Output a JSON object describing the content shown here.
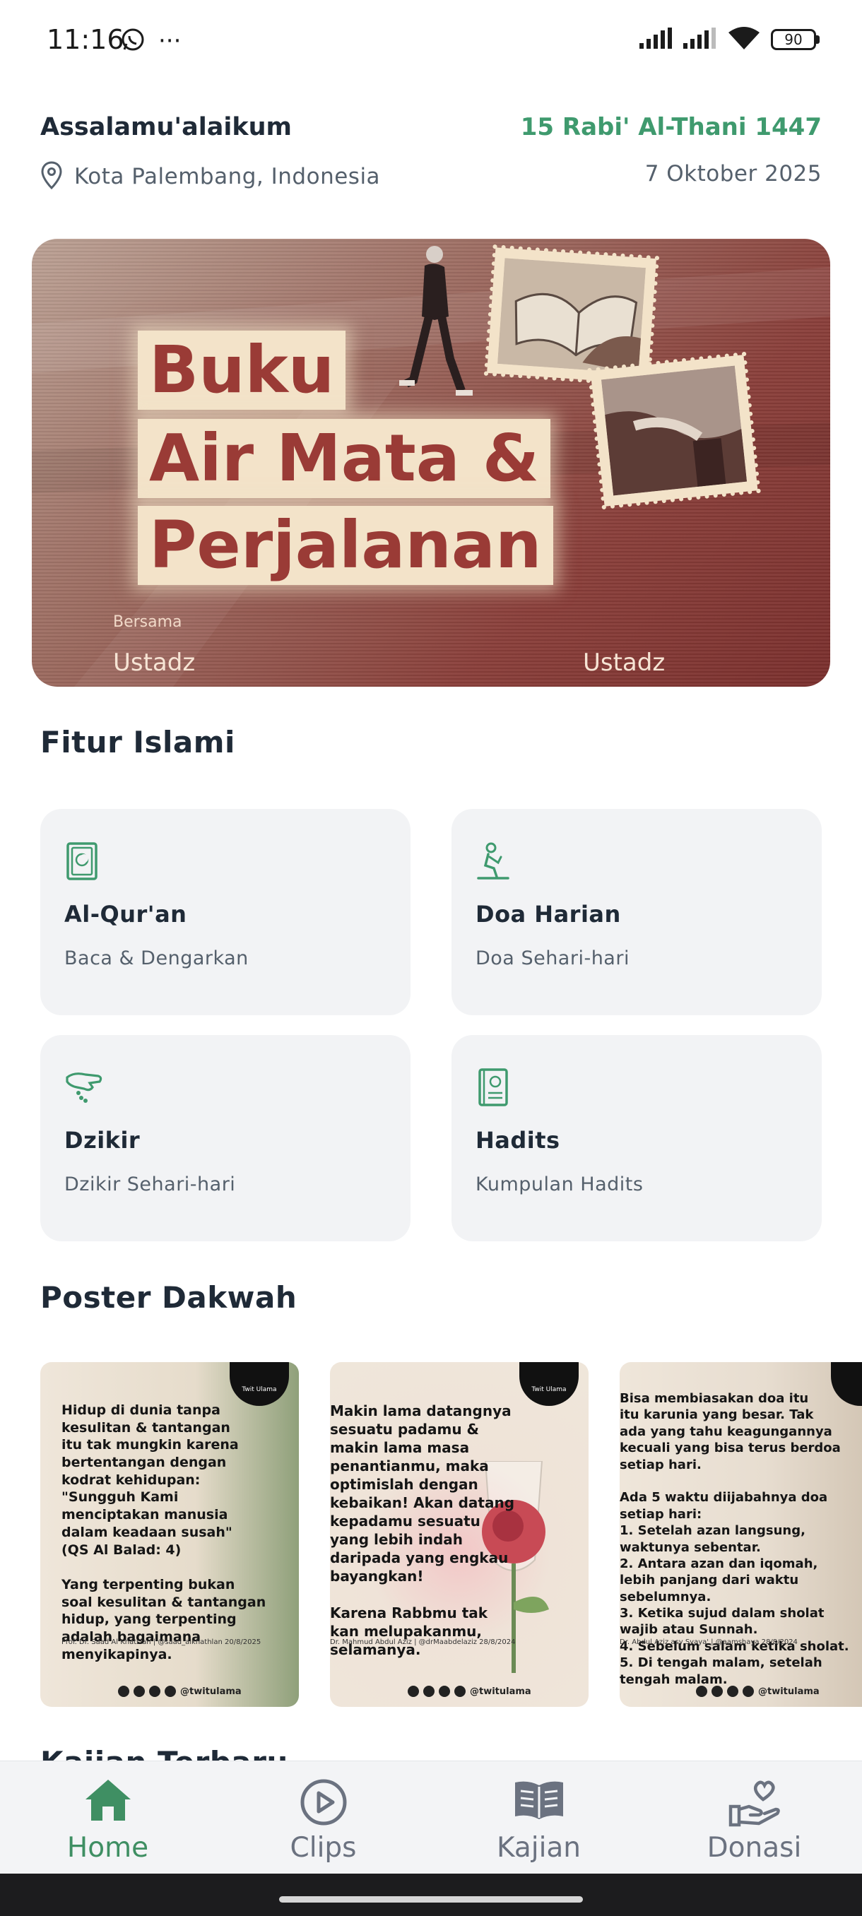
{
  "status_bar": {
    "time": "11:16",
    "battery": "90"
  },
  "header": {
    "greeting": "Assalamu'alaikum",
    "hijri_date": "15 Rabi' Al-Thani 1447",
    "location": "Kota Palembang, Indonesia",
    "gregorian_date": "7 Oktober 2025"
  },
  "banner": {
    "title_lines": [
      "Buku",
      "Air Mata &",
      "Perjalanan"
    ],
    "with_label": "Bersama",
    "speaker_1": "Ustadz",
    "speaker_2": "Ustadz"
  },
  "features": {
    "title": "Fitur Islami",
    "items": [
      {
        "title": "Al-Qur'an",
        "subtitle": "Baca & Dengarkan",
        "icon": "quran-book-icon"
      },
      {
        "title": "Doa Harian",
        "subtitle": "Doa Sehari-hari",
        "icon": "praying-person-icon"
      },
      {
        "title": "Dzikir",
        "subtitle": "Dzikir Sehari-hari",
        "icon": "tasbih-hand-icon"
      },
      {
        "title": "Hadits",
        "subtitle": "Kumpulan Hadits",
        "icon": "hadith-book-icon"
      }
    ]
  },
  "posters": {
    "title": "Poster Dakwah",
    "items": [
      {
        "text": "Hidup di dunia tanpa\nkesulitan & tantangan\nitu tak mungkin karena\nbertentangan dengan\nkodrat kehidupan:\n\"Sungguh Kami\nmenciptakan manusia\ndalam keadaan susah\"\n(QS Al Balad: 4)\n\nYang terpenting bukan\nsoal kesulitan & tantangan\nhidup, yang terpenting\nadalah bagaimana\nmenyikapinya.",
        "credit": "Prof. Dr. Saad Al Khatslan | @saad_alkhathlan 20/8/2025",
        "handle": "@twitulama",
        "badge": "Twit Ulama"
      },
      {
        "text": "Makin lama datangnya\nsesuatu padamu &\nmakin lama masa\npenantianmu, maka\noptimislah dengan\nkebaikan! Akan datang\nkepadamu sesuatu\nyang lebih indah\ndaripada yang engkau\nbayangkan!\n\nKarena Rabbmu tak\nkan melupakanmu,\nselamanya.",
        "credit": "Dr. Mahmud Abdul Aziz | @drMaabdelaziz 28/8/2024",
        "handle": "@twitulama",
        "badge": "Twit Ulama"
      },
      {
        "text": "Bisa membiasakan doa itu\nitu karunia yang besar. Tak\nada yang tahu keagungannya\nkecuali yang bisa terus berdoa\nsetiap hari.\n\nAda 5 waktu diijabahnya doa\nsetiap hari:\n1. Setelah azan langsung,\nwaktunya sebentar.\n2. Antara azan dan iqomah,\nlebih panjang dari waktu\nsebelumnya.\n3. Ketika sujud dalam sholat\nwajib atau Sunnah.\n4. Sebelum salam ketika sholat.\n5. Di tengah malam, setelah\ntengah malam.",
        "credit": "Dr. Abdul Aziz asy Syaya' | @aamshaya 28/8/2024",
        "handle": "@twitulama",
        "badge": ""
      }
    ]
  },
  "next_section": {
    "title": "Kajian Terbaru"
  },
  "bottom_nav": {
    "items": [
      {
        "label": "Home",
        "icon": "home-icon",
        "active": true
      },
      {
        "label": "Clips",
        "icon": "play-circle-icon",
        "active": false
      },
      {
        "label": "Kajian",
        "icon": "open-book-icon",
        "active": false
      },
      {
        "label": "Donasi",
        "icon": "heart-hand-icon",
        "active": false
      }
    ]
  },
  "colors": {
    "accent": "#3f9a6e",
    "card_bg": "#f2f3f5",
    "text_primary": "#1f2a37",
    "text_secondary": "#55606c",
    "nav_inactive": "#6b7280"
  }
}
